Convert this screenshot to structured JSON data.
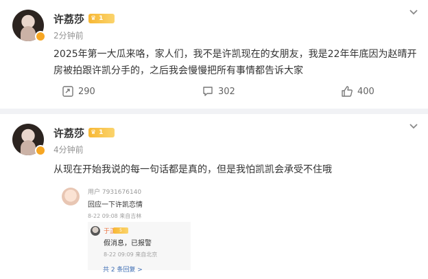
{
  "posts": [
    {
      "author": "许荔莎",
      "vip_level": "1",
      "time": "2分钟前",
      "text": "2025年第一大瓜来咯，家人们，我不是许凯现在的女朋友，我是22年年底因为赵晴开房被拍跟许凯分手的，之后我会慢慢把所有事情都告诉大家",
      "repost_count": "290",
      "comment_count": "302",
      "like_count": "400"
    },
    {
      "author": "许荔莎",
      "vip_level": "1",
      "time": "4分钟前",
      "text": "从现在开始我说的每一句话都是真的，但是我怕凯凯会承受不住哦",
      "quote": {
        "user": "用户 7931676140",
        "text": "回应一下许凯恋情",
        "meta": "8-22 09:08  来自吉林",
        "reply": {
          "name": "于正",
          "vip_label": "5",
          "text": "假消息，已报警",
          "meta": "8-22 09:09  来自北京"
        },
        "more_replies": "共 2 条回复 >"
      }
    }
  ],
  "colors": {
    "accent_orange": "#f6a623",
    "name_link": "#eb7340",
    "link_blue": "#3f6fb5"
  },
  "icons": {
    "repost": "repost-icon",
    "comment": "comment-icon",
    "like": "thumbs-up-icon",
    "menu": "chevron-down-icon"
  }
}
